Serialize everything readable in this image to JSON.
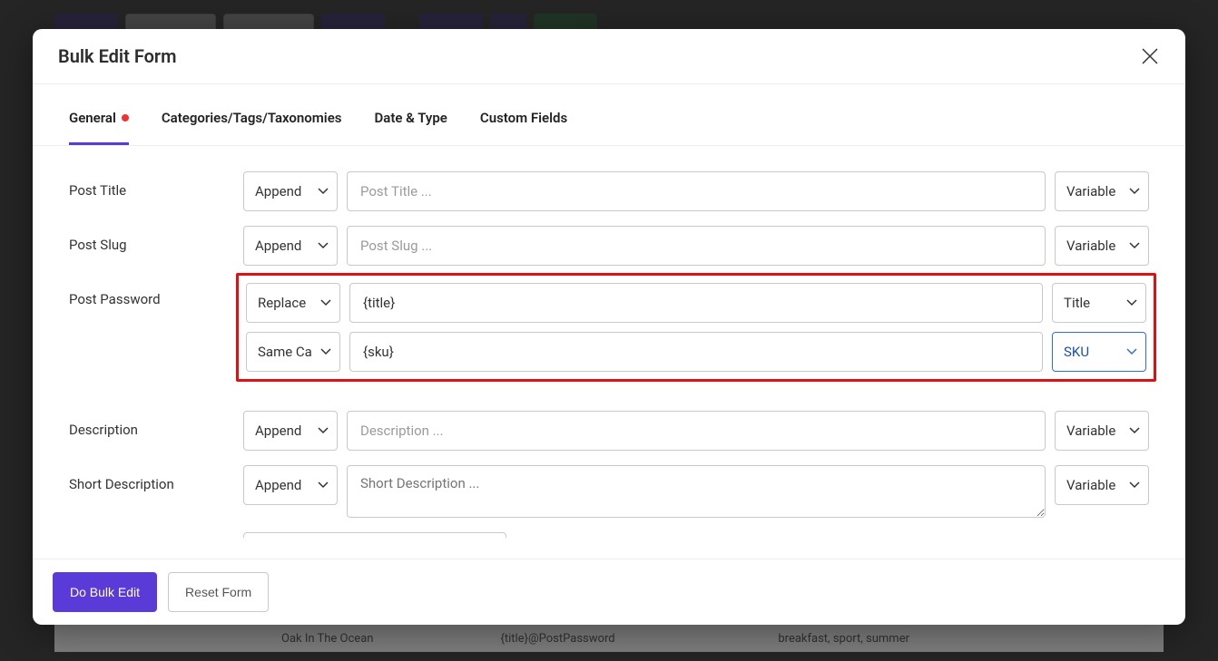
{
  "modal": {
    "title": "Bulk Edit Form"
  },
  "tabs": {
    "general": "General",
    "categories": "Categories/Tags/Taxonomies",
    "date_type": "Date & Type",
    "custom_fields": "Custom Fields"
  },
  "fields": {
    "post_title": {
      "label": "Post Title",
      "mode": "Append",
      "placeholder": "Post Title ...",
      "value": "",
      "var": "Variable"
    },
    "post_slug": {
      "label": "Post Slug",
      "mode": "Append",
      "placeholder": "Post Slug ...",
      "value": "",
      "var": "Variable"
    },
    "post_password": {
      "label": "Post Password",
      "line1": {
        "mode": "Replace",
        "value": "{title}",
        "var": "Title"
      },
      "line2": {
        "case": "Same Case",
        "value": "{sku}",
        "var": "SKU"
      }
    },
    "description": {
      "label": "Description",
      "mode": "Append",
      "placeholder": "Description ...",
      "value": "",
      "var": "Variable"
    },
    "short_description": {
      "label": "Short Description",
      "mode": "Append",
      "placeholder": "Short Description ...",
      "value": "",
      "var": "Variable"
    }
  },
  "footer": {
    "do_bulk": "Do Bulk Edit",
    "reset": "Reset Form"
  },
  "background": {
    "row_title": "Oak In The Ocean",
    "row_meta": "{title}@PostPassword",
    "row_tags": "breakfast, sport, summer"
  }
}
